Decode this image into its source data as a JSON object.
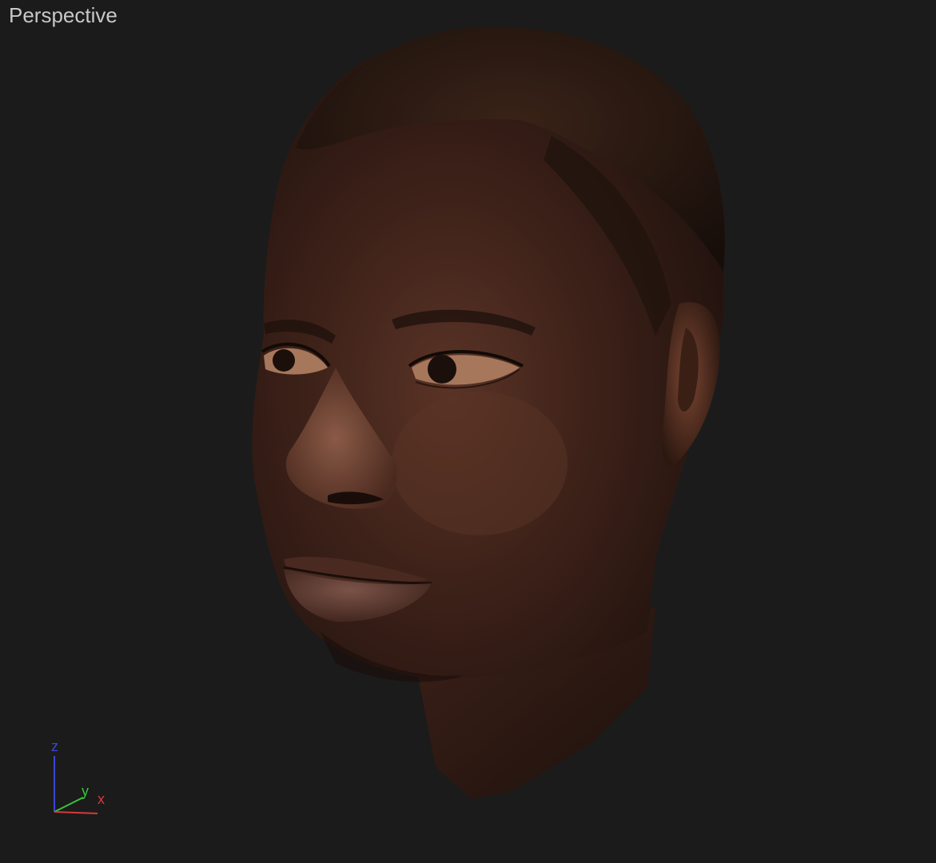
{
  "viewport": {
    "label": "Perspective",
    "background": "#1b1b1b"
  },
  "scene": {
    "object": "head-mesh",
    "colors": {
      "skin_dark": "#2a1712",
      "skin_mid": "#4a2a20",
      "skin_light": "#7a4a38",
      "hair": "#1e1410"
    }
  },
  "gizmo": {
    "axes": [
      {
        "label": "z",
        "color": "#3a46d6"
      },
      {
        "label": "y",
        "color": "#3ac23a"
      },
      {
        "label": "x",
        "color": "#d63a3a"
      }
    ]
  }
}
